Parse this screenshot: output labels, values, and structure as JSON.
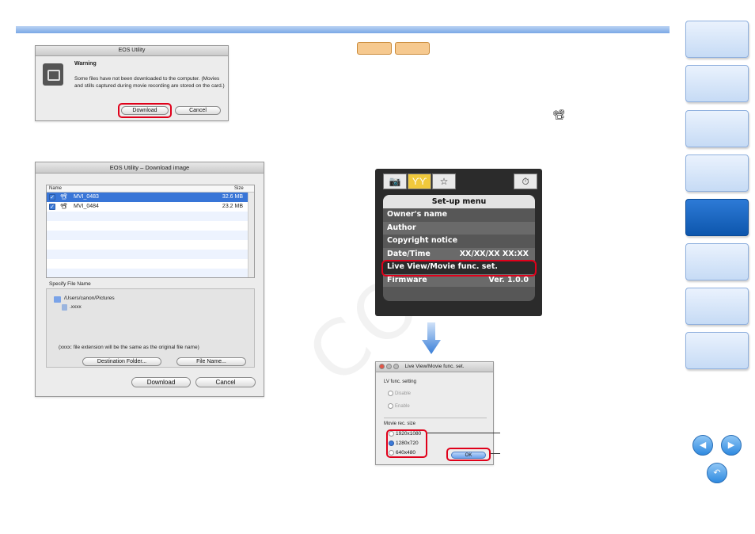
{
  "tags": [
    "",
    ""
  ],
  "watermark": "COPY",
  "movie_glyph": "📽",
  "warning_dialog": {
    "title": "EOS Utility",
    "heading": "Warning",
    "message": "Some files have not been downloaded to the computer. (Movies and stills captured during movie recording are stored on the card.)",
    "download_label": "Download",
    "cancel_label": "Cancel"
  },
  "download_window": {
    "title": "EOS Utility – Download image",
    "columns": {
      "name": "Name",
      "size": "Size"
    },
    "files": [
      {
        "name": "MVI_0483",
        "size": "32.6 MB",
        "selected": true
      },
      {
        "name": "MVI_0484",
        "size": "23.2 MB",
        "selected": false
      }
    ],
    "specify_label": "Specify File Name",
    "path": "/Users/canon/Pictures",
    "filename": ".xxxx",
    "note": "(xxxx: file extension will be the same as the original file name)",
    "destination_label": "Destination Folder...",
    "file_name_label": "File Name...",
    "download_label": "Download",
    "cancel_label": "Cancel"
  },
  "camera_menu": {
    "tabs": [
      "📷",
      "ϒϒ",
      "☆",
      "⏱"
    ],
    "header": "Set-up menu",
    "items": [
      {
        "label": "Owner's name",
        "value": ""
      },
      {
        "label": "Author",
        "value": ""
      },
      {
        "label": "Copyright notice",
        "value": ""
      },
      {
        "label": "Date/Time",
        "value": "XX/XX/XX XX:XX"
      },
      {
        "label": "Live View/Movie func. set.",
        "value": ""
      },
      {
        "label": "Firmware",
        "value": "Ver. 1.0.0"
      }
    ]
  },
  "liveview_window": {
    "title": "Live View/Movie func. set.",
    "lv_label": "LV func. setting",
    "lv_options": [
      "Disable",
      "Enable"
    ],
    "movie_label": "Movie rec. size",
    "movie_options": [
      "1920x1080",
      "1280x720",
      "640x480"
    ],
    "movie_selected": 1,
    "ok_label": "OK"
  },
  "colors": {
    "accent": "#e0001a",
    "nav_active": "#0d56ad",
    "nav_idle": "#d3e3f8"
  },
  "nav": {
    "tab_count": 8,
    "active_index": 4,
    "prev": "◀",
    "next": "▶",
    "back": "↶"
  }
}
